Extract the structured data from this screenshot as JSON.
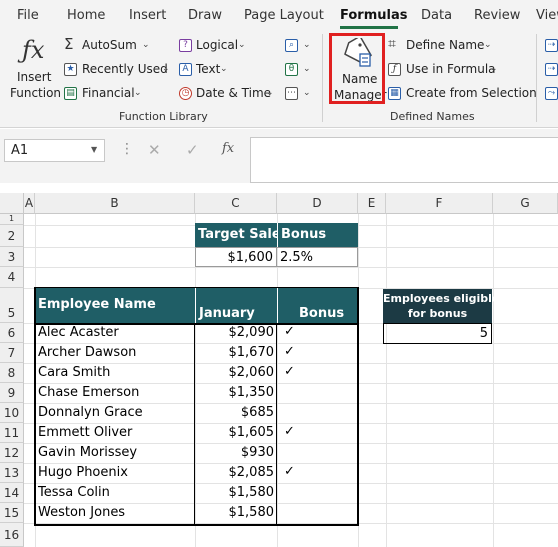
{
  "menu": {
    "tabs": [
      "File",
      "Home",
      "Insert",
      "Draw",
      "Page Layout",
      "Formulas",
      "Data",
      "Review",
      "View"
    ],
    "active": "Formulas"
  },
  "ribbon": {
    "insert_function": {
      "line1": "Insert",
      "line2": "Function"
    },
    "function_library": {
      "autosum": "AutoSum",
      "recently_used": "Recently Used",
      "financial": "Financial",
      "logical": "Logical",
      "text": "Text",
      "date_time": "Date & Time",
      "label": "Function Library"
    },
    "defined_names": {
      "name_manager_line1": "Name",
      "name_manager_line2": "Manager",
      "define_name": "Define Name",
      "use_in_formula": "Use in Formula",
      "create_from_selection": "Create from Selection",
      "label": "Defined Names"
    }
  },
  "formula_bar": {
    "name_box": "A1",
    "fx": "fx",
    "formula": ""
  },
  "columns": [
    "A",
    "B",
    "C",
    "D",
    "E",
    "F",
    "G"
  ],
  "rows": [
    "1",
    "2",
    "3",
    "4",
    "5",
    "6",
    "7",
    "8",
    "9",
    "10",
    "11",
    "12",
    "13",
    "14",
    "15",
    "16"
  ],
  "target": {
    "header_target": "Target Sales",
    "header_bonus": "Bonus",
    "value_target": "$1,600",
    "value_bonus": "2.5%"
  },
  "table": {
    "header_name": "Employee Name",
    "header_january": "January",
    "header_bonus": "Bonus",
    "rows": [
      {
        "name": "Alec Acaster",
        "january": "$2,090",
        "bonus": "✓"
      },
      {
        "name": "Archer Dawson",
        "january": "$1,670",
        "bonus": "✓"
      },
      {
        "name": "Cara Smith",
        "january": "$2,060",
        "bonus": "✓"
      },
      {
        "name": "Chase Emerson",
        "january": "$1,350",
        "bonus": ""
      },
      {
        "name": "Donnalyn Grace",
        "january": "$685",
        "bonus": ""
      },
      {
        "name": "Emmett Oliver",
        "january": "$1,605",
        "bonus": "✓"
      },
      {
        "name": "Gavin Morissey",
        "january": "$930",
        "bonus": ""
      },
      {
        "name": "Hugo Phoenix",
        "january": "$2,085",
        "bonus": "✓"
      },
      {
        "name": "Tessa Colin",
        "january": "$1,580",
        "bonus": ""
      },
      {
        "name": "Weston Jones",
        "january": "$1,580",
        "bonus": ""
      }
    ]
  },
  "eligible": {
    "header_line1": "Employees eligible",
    "header_line2": "for bonus",
    "value": "5"
  },
  "colors": {
    "header_fill": "#1f5e66",
    "accent": "#217346",
    "highlight": "#e02020"
  }
}
